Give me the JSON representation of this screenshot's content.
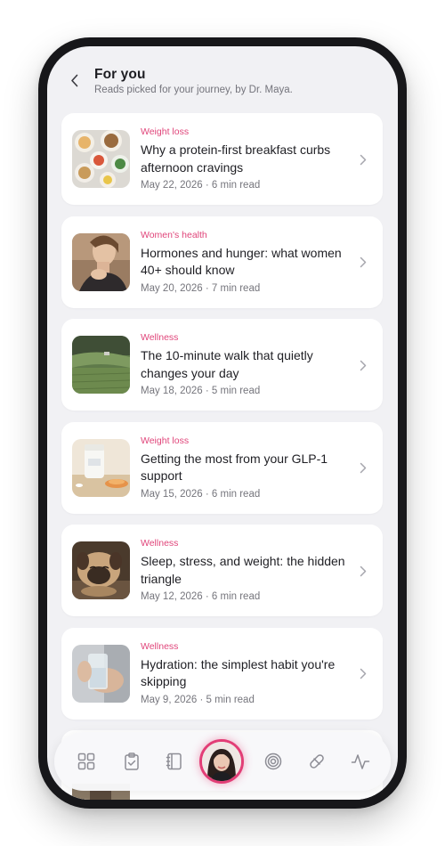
{
  "header": {
    "back_label": "Back",
    "title": "For you",
    "subtitle": "Reads picked for your journey, by Dr. Maya."
  },
  "articles": [
    {
      "category": "Weight loss",
      "title": "Why a protein-first breakfast curbs afternoon cravings",
      "meta": "May 22, 2026 · 6 min read",
      "image": "breakfast-bowls"
    },
    {
      "category": "Women's health",
      "title": "Hormones and hunger: what women 40+ should know",
      "meta": "May 20, 2026 · 7 min read",
      "image": "woman-portrait"
    },
    {
      "category": "Wellness",
      "title": "The 10-minute walk that quietly changes your day",
      "meta": "May 18, 2026 · 5 min read",
      "image": "green-field"
    },
    {
      "category": "Weight loss",
      "title": "Getting the most from your GLP-1 support",
      "meta": "May 15, 2026 · 6 min read",
      "image": "supplement-bottle"
    },
    {
      "category": "Wellness",
      "title": "Sleep, stress, and weight: the hidden triangle",
      "meta": "May 12, 2026 · 6 min read",
      "image": "sleeping-pug"
    },
    {
      "category": "Wellness",
      "title": "Hydration: the simplest habit you're skipping",
      "meta": "May 9, 2026 · 5 min read",
      "image": "glass-of-water"
    }
  ],
  "tabbar": {
    "items": [
      "grid-icon",
      "clipboard-check-icon",
      "notebook-icon",
      "profile-avatar",
      "target-icon",
      "pill-icon",
      "activity-icon"
    ],
    "accent": "#e23e76"
  },
  "colors": {
    "category": "#e0457a",
    "background": "#f1f1f4",
    "card": "#ffffff"
  }
}
